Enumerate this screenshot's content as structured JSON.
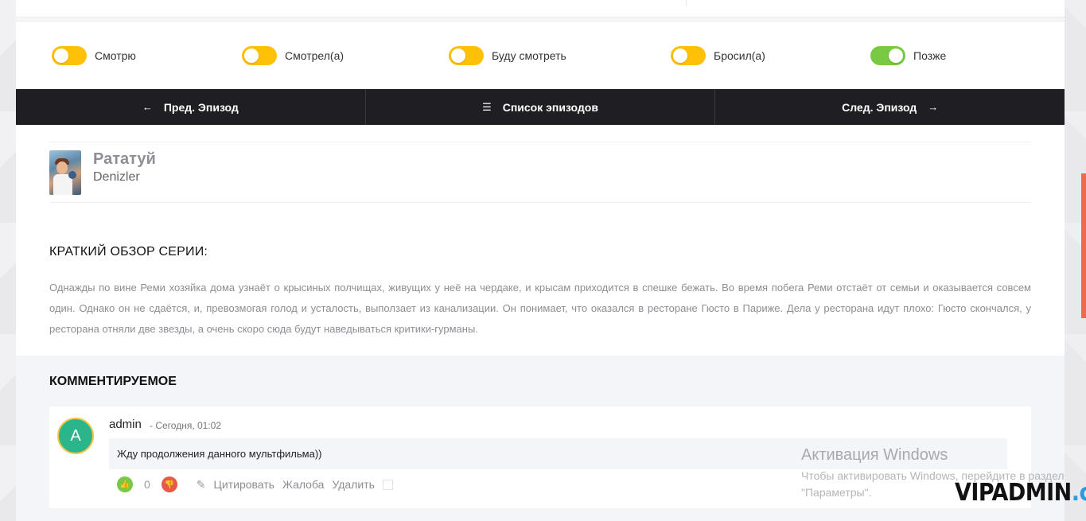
{
  "toggles": [
    {
      "label": "Смотрю",
      "state": "off",
      "color": "#ffc107"
    },
    {
      "label": "Смотрел(а)",
      "state": "off",
      "color": "#ffc107"
    },
    {
      "label": "Буду смотреть",
      "state": "off",
      "color": "#ffc107"
    },
    {
      "label": "Бросил(а)",
      "state": "off",
      "color": "#ffc107"
    },
    {
      "label": "Позже",
      "state": "on",
      "color": "#7ac943"
    }
  ],
  "nav": {
    "prev": {
      "label": "Пред. Эпизод",
      "icon": "arrow-left-icon"
    },
    "list": {
      "label": "Список эпизодов",
      "icon": "list-icon"
    },
    "next": {
      "label": "След. Эпизод",
      "icon": "arrow-right-icon"
    }
  },
  "episode": {
    "title": "Рататуй",
    "subtitle": "Denizler"
  },
  "synopsis": {
    "heading": "КРАТКИЙ ОБЗОР СЕРИИ:",
    "text": "Однажды по вине Реми хозяйка дома узнаёт о крысиных полчищах, живущих у неё на чердаке, и крысам приходится в спешке бежать. Во время побега Реми отстаёт от семьи и оказывается совсем один. Однако он не сдаётся, и, превозмогая голод и усталость, выползает из канализации. Он понимает, что оказался в ресторане Гюсто в Париже. Дела у ресторана идут плохо: Гюсто скончался, у ресторана отняли две звезды, а очень скоро сюда будут наведываться критики-гурманы."
  },
  "comments": {
    "heading": "КОММЕНТИРУЕМОЕ",
    "items": [
      {
        "avatar_letter": "A",
        "author": "admin",
        "date": "- Сегодня, 01:02",
        "text": "Жду продолжения данного мультфильма))",
        "votes": "0",
        "actions": {
          "quote": "Цитировать",
          "report": "Жалоба",
          "delete": "Удалить"
        }
      }
    ]
  },
  "overlay": {
    "windows_title": "Активация Windows",
    "windows_text": "Чтобы активировать Windows, перейдите в раздел \"Параметры\".",
    "watermark_main": "VIPADMIN",
    "watermark_accent": ".club"
  },
  "colors": {
    "accent_yellow": "#ffc107",
    "accent_green": "#7ac943",
    "navbar_bg": "#1f1f23",
    "downvote_red": "#e8584b",
    "scroll_indicator": "#f06a4a"
  }
}
